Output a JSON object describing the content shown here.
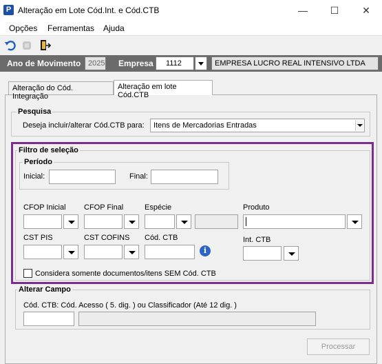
{
  "window": {
    "title": "Alteração em Lote Cód.Int. e Cód.CTB",
    "app_icon": "P",
    "minimize": "—",
    "maximize": "☐",
    "close": "✕"
  },
  "menu": {
    "items": [
      "Opções",
      "Ferramentas",
      "Ajuda"
    ]
  },
  "toolbar": {
    "icons": [
      "undo-icon",
      "disabled-icon",
      "exit-icon"
    ]
  },
  "header": {
    "ano_label": "Ano de Movimento",
    "ano_value": "2025",
    "empresa_label": "Empresa",
    "empresa_code": "1112",
    "empresa_name": "EMPRESA LUCRO REAL INTENSIVO LTDA"
  },
  "tabs": [
    {
      "label": "Alteração do Cód. Integração",
      "active": false
    },
    {
      "label": "Alteração em lote Cód.CTB",
      "active": true
    }
  ],
  "pesquisa": {
    "title": "Pesquisa",
    "prompt": "Deseja incluir/alterar Cód.CTB para:",
    "selected": "Itens de Mercadorias Entradas"
  },
  "filtro": {
    "title": "Filtro de seleção",
    "periodo_title": "Período",
    "inicial_label": "Inicial:",
    "final_label": "Final:",
    "cfop_inicial_label": "CFOP Inicial",
    "cfop_final_label": "CFOP Final",
    "especie_label": "Espécie",
    "produto_label": "Produto",
    "cst_pis_label": "CST PIS",
    "cst_cofins_label": "CST COFINS",
    "cod_ctb_label": "Cód. CTB",
    "int_ctb_label": "Int. CTB",
    "checkbox_label": "Considera somente documentos/itens SEM Cód. CTB",
    "checkbox_checked": false
  },
  "alterar": {
    "title": "Alterar Campo",
    "description": "Cód. CTB: Cód. Acesso ( 5. dig. ) ou Classificador (Até 12 dig. )"
  },
  "actions": {
    "processar_label": "Processar"
  },
  "colors": {
    "filter_border": "#7b2c8f",
    "header_band": "#6b6b6b",
    "info_icon": "#2c63c7"
  }
}
